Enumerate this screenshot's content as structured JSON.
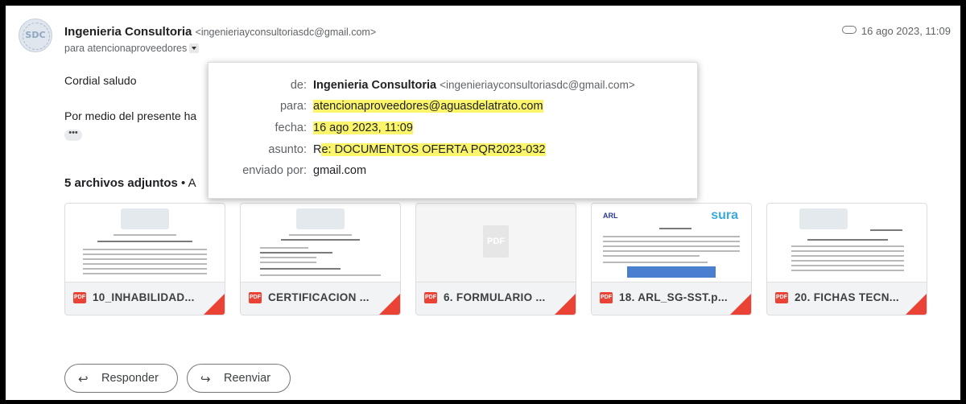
{
  "sender": {
    "name": "Ingenieria Consultoria",
    "email": "<ingenieriayconsultoriasdc@gmail.com>",
    "avatar_text": "SDC"
  },
  "recipient_line": "para atencionaproveedores",
  "date": "16 ago 2023, 11:09",
  "body": {
    "greeting": "Cordial saludo",
    "line2": "Por medio del presente ha",
    "ellipsis": "•••"
  },
  "popup": {
    "from_label": "de:",
    "from_name": "Ingenieria Consultoria",
    "from_email": "<ingenieriayconsultoriasdc@gmail.com>",
    "to_label": "para:",
    "to_value": "atencionaproveedores@aguasdelatrato.com",
    "date_label": "fecha:",
    "date_value": "16 ago 2023, 11:09",
    "subject_label": "asunto:",
    "subject_prefix": "R",
    "subject_rest": "e: DOCUMENTOS OFERTA PQR2023-032",
    "sent_label": "enviado por:",
    "sent_value": "gmail.com"
  },
  "attachments": {
    "header": "5 archivos adjuntos",
    "header_suffix": " •  A",
    "files": [
      {
        "name": "10_INHABILIDAD...",
        "badge": "PDF"
      },
      {
        "name": "CERTIFICACION ...",
        "badge": "PDF"
      },
      {
        "name": "6. FORMULARIO ...",
        "badge": "PDF"
      },
      {
        "name": "18. ARL_SG-SST.p...",
        "badge": "PDF"
      },
      {
        "name": "20. FICHAS TECN...",
        "badge": "PDF"
      }
    ],
    "placeholder_text": "PDF",
    "arl_text": "ARL",
    "sura_text": "sura"
  },
  "actions": {
    "reply": "Responder",
    "forward": "Reenviar"
  },
  "colors": {
    "highlight": "#fbf56b",
    "pdf_red": "#ea4335",
    "text": "#202124",
    "muted": "#5f6368"
  }
}
